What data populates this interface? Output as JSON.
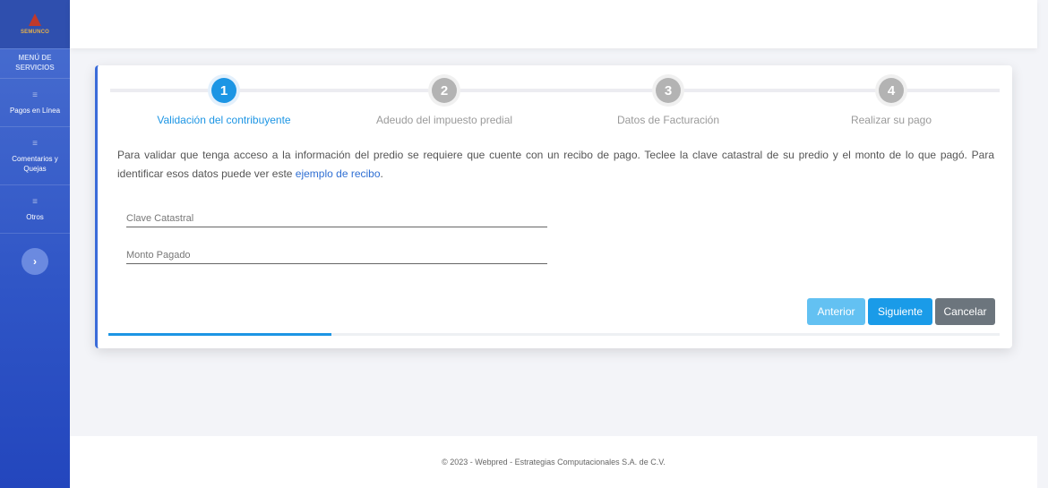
{
  "sidebar": {
    "logo_text": "SEMUNCO",
    "menu_title": "MENÚ DE SERVICIOS",
    "items": [
      {
        "label": "Pagos en Línea",
        "icon": "menu-icon"
      },
      {
        "label": "Comentarios y Quejas",
        "icon": "menu-icon"
      },
      {
        "label": "Otros",
        "icon": "menu-icon"
      }
    ],
    "expand_icon": "›"
  },
  "wizard": {
    "steps": [
      {
        "number": "1",
        "label": "Validación del contribuyente",
        "active": true
      },
      {
        "number": "2",
        "label": "Adeudo del impuesto predial",
        "active": false
      },
      {
        "number": "3",
        "label": "Datos de Facturación",
        "active": false
      },
      {
        "number": "4",
        "label": "Realizar su pago",
        "active": false
      }
    ],
    "intro_text": "Para validar que tenga acceso a la información del predio se requiere que cuente con un recibo de pago. Teclee la clave catastral de su predio y el monto de lo que pagó. Para identificar esos datos puede ver este ",
    "intro_link": "ejemplo de recibo",
    "intro_end": ".",
    "fields": {
      "clave_placeholder": "Clave Catastral",
      "clave_value": "",
      "monto_placeholder": "Monto Pagado",
      "monto_value": ""
    },
    "buttons": {
      "prev": "Anterior",
      "next": "Siguiente",
      "cancel": "Cancelar"
    },
    "progress": 0.25
  },
  "colors": {
    "accent": "#1c95e4",
    "sidebar": "#2f55c6",
    "cancel": "#6c757d"
  },
  "footer": {
    "text": "© 2023 - Webpred - Estrategias Computacionales S.A. de C.V."
  }
}
